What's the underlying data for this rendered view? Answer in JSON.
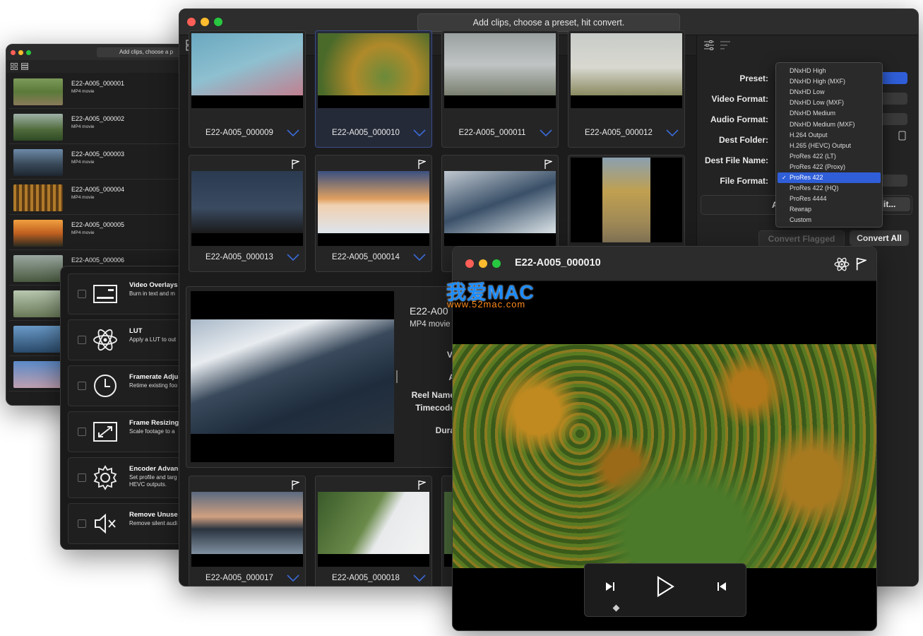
{
  "list_window": {
    "title": "Add clips, choose a p",
    "items": [
      {
        "name": "E22-A005_000001",
        "type": "MP4 movie"
      },
      {
        "name": "E22-A005_000002",
        "type": "MP4 movie"
      },
      {
        "name": "E22-A005_000003",
        "type": "MP4 movie"
      },
      {
        "name": "E22-A005_000004",
        "type": "MP4 movie"
      },
      {
        "name": "E22-A005_000005",
        "type": "MP4 movie"
      },
      {
        "name": "E22-A005_000006",
        "type": ""
      }
    ]
  },
  "features": [
    {
      "title": "Video Overlays",
      "desc": "Burn in text and m",
      "icon": "overlay-icon"
    },
    {
      "title": "LUT",
      "desc": "Apply a LUT to out",
      "icon": "atom-icon"
    },
    {
      "title": "Framerate Adju",
      "desc": "Retime existing foo",
      "icon": "clock-icon"
    },
    {
      "title": "Frame Resizing",
      "desc": "Scale footage to a",
      "icon": "resize-icon"
    },
    {
      "title": "Encoder Advan",
      "desc": "Set profile and targ HEVC outputs.",
      "icon": "gear-icon"
    },
    {
      "title": "Remove Unuse",
      "desc": "Remove silent audi",
      "icon": "mute-icon"
    }
  ],
  "main_window": {
    "title": "Add clips, choose a preset, hit convert.",
    "tiles": [
      {
        "name": "E22-A005_000009",
        "flag": false,
        "selected": false
      },
      {
        "name": "E22-A005_000010",
        "flag": false,
        "selected": true
      },
      {
        "name": "E22-A005_000011",
        "flag": false,
        "selected": false
      },
      {
        "name": "E22-A005_000012",
        "flag": false,
        "selected": false
      },
      {
        "name": "E22-A005_000013",
        "flag": true,
        "selected": false
      },
      {
        "name": "E22-A005_000014",
        "flag": true,
        "selected": false
      },
      {
        "name": "",
        "flag": true,
        "selected": false
      },
      {
        "name": "",
        "flag": true,
        "selected": false
      },
      {
        "name": "E22-A005_000017",
        "flag": true,
        "selected": false
      },
      {
        "name": "E22-A005_000018",
        "flag": true,
        "selected": false
      }
    ],
    "details": {
      "title": "E22-A00",
      "type": "MP4 movie",
      "labels": [
        "Vi",
        "A",
        "Reel Name",
        "Timecode",
        "Dura"
      ]
    },
    "sidebar": {
      "labels": [
        "Preset:",
        "Video Format:",
        "Audio Format:",
        "Dest Folder:",
        "Dest File Name:",
        "File Format:"
      ],
      "add_button": "A",
      "edit_button": "dit...",
      "convert_flagged": "Convert Flagged",
      "convert_all": "Convert All"
    }
  },
  "preset_dropdown": {
    "options": [
      "DNxHD High",
      "DNxHD High (MXF)",
      "DNxHD Low",
      "DNxHD Low (MXF)",
      "DNxHD Medium",
      "DNxHD Medium (MXF)",
      "H.264 Output",
      "H.265 (HEVC) Output",
      "ProRes 422 (LT)",
      "ProRes 422 (Proxy)",
      "ProRes 422",
      "ProRes 422 (HQ)",
      "ProRes 4444",
      "Rewrap",
      "Custom"
    ],
    "selected": "ProRes 422",
    "checkmark": "✓"
  },
  "player": {
    "title": "E22-A005_000010"
  },
  "watermark": {
    "brand": "我爱MAC",
    "url": "www.52mac.com"
  },
  "colors": {
    "accent": "#2f5ed8",
    "close": "#ff5f57",
    "minimize": "#febc2e",
    "zoom": "#28c840"
  }
}
